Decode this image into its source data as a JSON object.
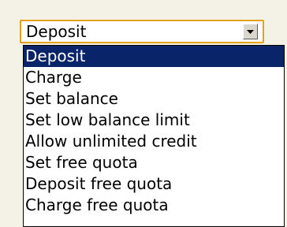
{
  "select": {
    "value": "Deposit",
    "button_icon": "chevron-down-icon"
  },
  "options": [
    "Deposit",
    "Charge",
    "Set balance",
    "Set low balance limit",
    "Allow unlimited credit",
    "Set free quota",
    "Deposit free quota",
    "Charge free quota"
  ],
  "selected_index": 0,
  "colors": {
    "background": "#f4f1e6",
    "select_border": "#e3a21a",
    "highlight_bg": "#0a246a",
    "highlight_text": "#ffffff"
  }
}
